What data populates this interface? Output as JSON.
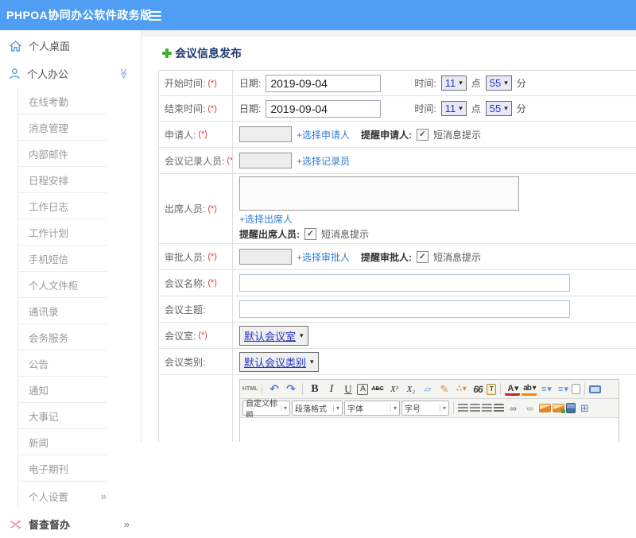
{
  "topbar": {
    "title": "PHPOA协同办公软件政务版"
  },
  "ui": {
    "caret": "▾",
    "check": "✓",
    "chevron_expanded": "≫",
    "chevron_more": "»"
  },
  "sidebar": {
    "desktop_label": "个人桌面",
    "office_label": "个人办公",
    "office_items": [
      "在线考勤",
      "消息管理",
      "内部邮件",
      "日程安排",
      "工作日志",
      "工作计划",
      "手机短信",
      "个人文件柜",
      "通讯录",
      "会务服务",
      "公告",
      "通知",
      "大事记",
      "新闻",
      "电子期刊"
    ],
    "settings_label": "个人设置",
    "supervision_label": "督查督办"
  },
  "page": {
    "title": "会议信息发布"
  },
  "form": {
    "required_mark": "(*)",
    "start_time": {
      "label": "开始时间:",
      "date_label": "日期:",
      "date_value": "2019-09-04",
      "time_label": "时间:",
      "hour": "11",
      "hour_unit": "点",
      "minute": "55",
      "minute_unit": "分"
    },
    "end_time": {
      "label": "结束时间:",
      "date_label": "日期:",
      "date_value": "2019-09-04",
      "time_label": "时间:",
      "hour": "11",
      "hour_unit": "点",
      "minute": "55",
      "minute_unit": "分"
    },
    "applicant": {
      "label": "申请人:",
      "link": "+选择申请人",
      "remind_label": "提醒申请人:",
      "sms_label": "短消息提示"
    },
    "recorder": {
      "label": "会议记录人员:",
      "link": "+选择记录员"
    },
    "attendees": {
      "label": "出席人员:",
      "link": "+选择出席人",
      "remind_label": "提醒出席人员:",
      "sms_label": "短消息提示"
    },
    "approver": {
      "label": "审批人员:",
      "link": "+选择审批人",
      "remind_label": "提醒审批人:",
      "sms_label": "短消息提示"
    },
    "meeting_name": {
      "label": "会议名称:"
    },
    "meeting_subject": {
      "label": "会议主题:"
    },
    "meeting_room": {
      "label": "会议室:",
      "value": "默认会议室"
    },
    "meeting_category": {
      "label": "会议类别:",
      "value": "默认会议类别"
    }
  },
  "editor": {
    "toolbar1": [
      {
        "name": "html-source-icon",
        "glyph": "HTML",
        "cls": "tb-html"
      },
      {
        "name": "toolbar-separator",
        "glyph": "",
        "cls": "tb-sep",
        "inter": "false"
      },
      {
        "name": "undo-icon",
        "glyph": "↶",
        "cls": "tb-undo"
      },
      {
        "name": "redo-icon",
        "glyph": "↷",
        "cls": "tb-undo"
      },
      {
        "name": "toolbar-separator",
        "glyph": "",
        "cls": "tb-sep",
        "inter": "false"
      },
      {
        "name": "bold-icon",
        "glyph": "B",
        "cls": "tb-b"
      },
      {
        "name": "italic-icon",
        "glyph": "I",
        "cls": "tb-i"
      },
      {
        "name": "underline-icon",
        "glyph": "U",
        "cls": "tb-u"
      },
      {
        "name": "font-frame-icon",
        "glyph": "A",
        "cls": "tb-boxa"
      },
      {
        "name": "strikethrough-icon",
        "glyph": "ABC",
        "cls": "tb-abc"
      },
      {
        "name": "superscript-icon",
        "glyph": "X²",
        "cls": "tb-x"
      },
      {
        "name": "subscript-icon",
        "glyph": "X₂",
        "cls": "tb-x"
      },
      {
        "name": "eraser-icon",
        "glyph": "▱",
        "cls": "tb-eraser"
      },
      {
        "name": "format-brush-icon",
        "glyph": "✎",
        "cls": "tb-brush"
      },
      {
        "name": "auto-typeset-icon",
        "glyph": "∴ ▾",
        "cls": "tb-magic"
      },
      {
        "name": "blockquote-icon",
        "glyph": "66",
        "cls": "tb-quote"
      },
      {
        "name": "paste-icon",
        "glyph": "T",
        "cls": "tb-paste"
      },
      {
        "name": "toolbar-separator",
        "glyph": "",
        "cls": "tb-sep",
        "inter": "false"
      },
      {
        "name": "font-color-icon",
        "glyph": "A ▾",
        "cls": "tb-fontcolor"
      },
      {
        "name": "highlight-color-icon",
        "glyph": "ab ▾",
        "cls": "tb-highlight"
      },
      {
        "name": "ordered-list-icon",
        "glyph": "≡ ▾",
        "cls": "tb-list"
      },
      {
        "name": "unordered-list-icon",
        "glyph": "≡ ▾",
        "cls": "tb-list"
      },
      {
        "name": "new-page-icon",
        "glyph": "",
        "cls": "tb-doc"
      },
      {
        "name": "toolbar-separator",
        "glyph": "",
        "cls": "tb-sep",
        "inter": "false"
      },
      {
        "name": "fullscreen-icon",
        "glyph": "",
        "cls": "tb-monitor"
      }
    ],
    "toolbar2": [
      {
        "name": "style-select",
        "glyph": "自定义标题",
        "cls": "tb-select tb-w1"
      },
      {
        "name": "paragraph-format-select",
        "glyph": "段落格式",
        "cls": "tb-select tb-w2"
      },
      {
        "name": "font-family-select",
        "glyph": "字体",
        "cls": "tb-select tb-w3"
      },
      {
        "name": "font-size-select",
        "glyph": "字号",
        "cls": "tb-select tb-w4"
      },
      {
        "name": "toolbar-separator",
        "glyph": "",
        "cls": "tb-sep",
        "inter": "false"
      },
      {
        "name": "align-left-icon",
        "glyph": "",
        "cls": "tb-bars"
      },
      {
        "name": "align-center-icon",
        "glyph": "",
        "cls": "tb-bars"
      },
      {
        "name": "align-right-icon",
        "glyph": "",
        "cls": "tb-bars"
      },
      {
        "name": "align-justify-icon",
        "glyph": "",
        "cls": "tb-bars tb-bars-j"
      },
      {
        "name": "link-icon",
        "glyph": "∞",
        "cls": "tb-link"
      },
      {
        "name": "anchor-icon",
        "glyph": "∞",
        "cls": "tb-link tb-anchor"
      },
      {
        "name": "image-icon",
        "glyph": "",
        "cls": "tb-img"
      },
      {
        "name": "image-upload-icon",
        "glyph": "",
        "cls": "tb-img tb-img-add"
      },
      {
        "name": "media-icon",
        "glyph": "",
        "cls": "tb-media"
      },
      {
        "name": "table-icon",
        "glyph": "⊞",
        "cls": "tb-table"
      }
    ]
  }
}
